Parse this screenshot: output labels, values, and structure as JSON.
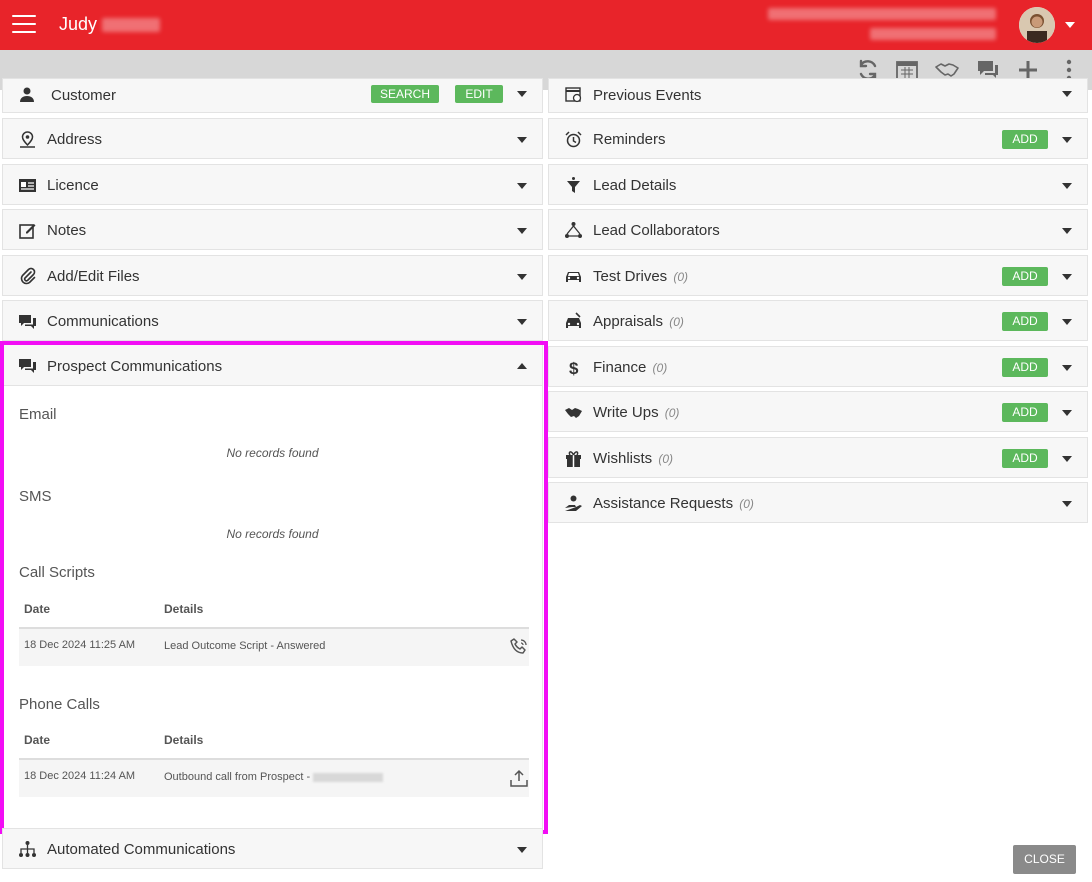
{
  "header": {
    "user_first_name": "Judy",
    "user_last_name_masked": "Tes███",
    "menu_icon": "hamburger-menu-icon",
    "accent_color": "#e8242a"
  },
  "toolbar": {
    "icons": [
      "refresh-icon",
      "calendar-icon",
      "handshake-icon",
      "chat-icon",
      "plus-icon",
      "more-vertical-icon"
    ]
  },
  "left_panels": {
    "customer": {
      "label": "Customer",
      "search": "SEARCH",
      "edit": "EDIT"
    },
    "address": {
      "label": "Address"
    },
    "licence": {
      "label": "Licence"
    },
    "notes": {
      "label": "Notes"
    },
    "files": {
      "label": "Add/Edit Files"
    },
    "communications": {
      "label": "Communications"
    },
    "automated": {
      "label": "Automated Communications"
    }
  },
  "prospect": {
    "title": "Prospect Communications",
    "email_title": "Email",
    "email_empty": "No records found",
    "sms_title": "SMS",
    "sms_empty": "No records found",
    "call_scripts": {
      "title": "Call Scripts",
      "col_date": "Date",
      "col_details": "Details",
      "rows": [
        {
          "date": "18 Dec 2024 11:25 AM",
          "details": "Lead Outcome Script - Answered"
        }
      ]
    },
    "phone_calls": {
      "title": "Phone Calls",
      "col_date": "Date",
      "col_details": "Details",
      "rows": [
        {
          "date": "18 Dec 2024 11:24 AM",
          "details": "Outbound call from Prospect - "
        }
      ]
    }
  },
  "right_panels": {
    "previous_events": {
      "label": "Previous Events"
    },
    "reminders": {
      "label": "Reminders",
      "add": "ADD"
    },
    "lead_details": {
      "label": "Lead Details"
    },
    "lead_collaborators": {
      "label": "Lead Collaborators"
    },
    "test_drives": {
      "label": "Test Drives",
      "count": "(0)",
      "add": "ADD"
    },
    "appraisals": {
      "label": "Appraisals",
      "count": "(0)",
      "add": "ADD"
    },
    "finance": {
      "label": "Finance",
      "count": "(0)",
      "add": "ADD"
    },
    "write_ups": {
      "label": "Write Ups",
      "count": "(0)",
      "add": "ADD"
    },
    "wishlists": {
      "label": "Wishlists",
      "count": "(0)",
      "add": "ADD"
    },
    "assistance": {
      "label": "Assistance Requests",
      "count": "(0)"
    }
  },
  "close_label": "CLOSE",
  "colors": {
    "add_button": "#5cb85c",
    "highlight": "#f20df5",
    "close_button": "#8a8a8a"
  }
}
